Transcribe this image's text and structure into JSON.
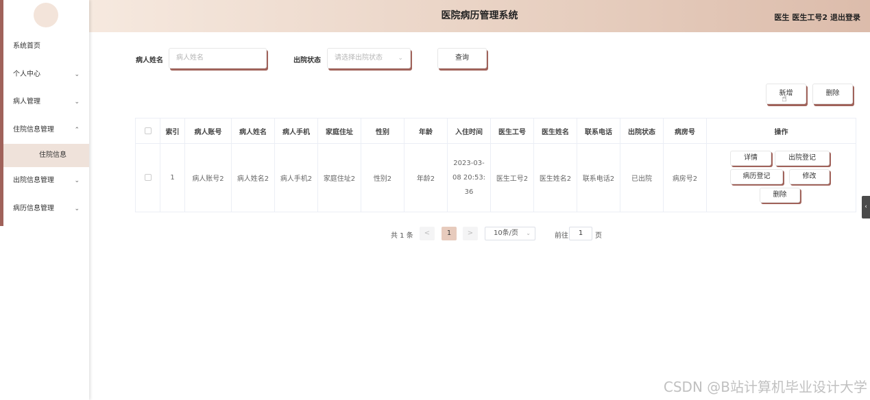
{
  "header": {
    "title": "医院病历管理系统",
    "role": "医生",
    "username": "医生工号2",
    "logout": "退出登录"
  },
  "sidebar": {
    "items": [
      {
        "label": "系统首页",
        "chevron": ""
      },
      {
        "label": "个人中心",
        "chevron": "⌄"
      },
      {
        "label": "病人管理",
        "chevron": "⌄"
      },
      {
        "label": "住院信息管理",
        "chevron": "⌃"
      },
      {
        "label": "出院信息管理",
        "chevron": "⌄"
      },
      {
        "label": "病历信息管理",
        "chevron": "⌄"
      }
    ],
    "sub_item": "住院信息"
  },
  "search": {
    "name_label": "病人姓名",
    "name_placeholder": "病人姓名",
    "status_label": "出院状态",
    "status_placeholder": "请选择出院状态",
    "query_button": "查询"
  },
  "actions": {
    "add": "新增",
    "delete": "删除"
  },
  "table": {
    "headers": [
      "索引",
      "病人账号",
      "病人姓名",
      "病人手机",
      "家庭住址",
      "性别",
      "年龄",
      "入住时间",
      "医生工号",
      "医生姓名",
      "联系电话",
      "出院状态",
      "病房号",
      "操作"
    ],
    "rows": [
      {
        "index": "1",
        "account": "病人账号2",
        "name": "病人姓名2",
        "phone": "病人手机2",
        "address": "家庭住址2",
        "gender": "性别2",
        "age": "年龄2",
        "checkin_line1": "2023-03-",
        "checkin_line2": "08 20:53:",
        "checkin_line3": "36",
        "doctor_id": "医生工号2",
        "doctor_name": "医生姓名2",
        "contact": "联系电话2",
        "discharge": "已出院",
        "ward": "病房号2",
        "ops": {
          "detail": "详情",
          "discharge_reg": "出院登记",
          "record_reg": "病历登记",
          "edit": "修改",
          "delete": "删除"
        }
      }
    ]
  },
  "pagination": {
    "total": "共 1 条",
    "prev": "<",
    "current": "1",
    "next": ">",
    "page_size": "10条/页",
    "goto_prefix": "前往",
    "goto_value": "1",
    "goto_suffix": "页"
  },
  "watermark": "CSDN @B站计算机毕业设计大学",
  "colors": {
    "accent": "#a0625a",
    "header_start": "#f6e9df",
    "header_end": "#dcbcab",
    "active_bg": "#efe2da"
  }
}
